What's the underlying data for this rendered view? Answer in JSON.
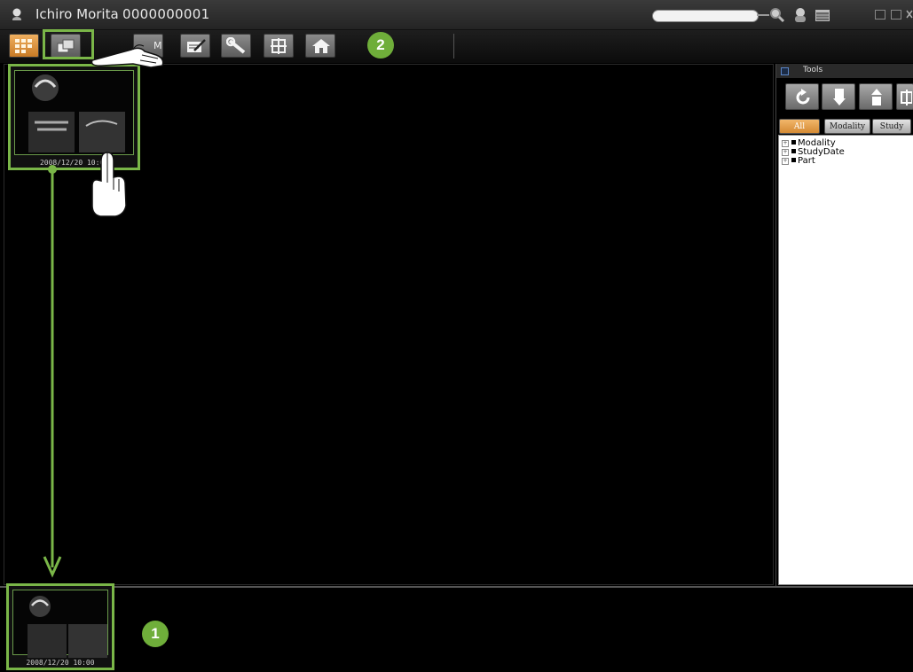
{
  "titlebar": {
    "patient_name": "Ichiro Morita",
    "patient_id": "0000000001",
    "search_value": ""
  },
  "toolbar": {
    "buttons": [
      {
        "icon": "grid-view-icon",
        "active": true
      },
      {
        "icon": "overlap-windows-icon",
        "active": false
      },
      {
        "icon": "dicom-icon",
        "active": false,
        "label": "M"
      },
      {
        "icon": "edit-text-icon",
        "active": false
      },
      {
        "icon": "wrench-icon",
        "active": false
      },
      {
        "icon": "tooth-tool-icon",
        "active": false
      },
      {
        "icon": "home-icon",
        "active": false
      }
    ]
  },
  "callouts": {
    "one": "1",
    "two": "2"
  },
  "thumbnails": {
    "main_date": "2008/12/20 10:00",
    "bottom_date": "2008/12/20 10:00"
  },
  "right_panel": {
    "tools_label": "Tools",
    "tabs": [
      "All",
      "Modality",
      "Study"
    ],
    "tree": [
      "Modality",
      "StudyDate",
      "Part"
    ]
  },
  "colors": {
    "highlight_green": "#7ab648",
    "badge_green": "#6fae3a",
    "active_orange": "#d48a34"
  }
}
